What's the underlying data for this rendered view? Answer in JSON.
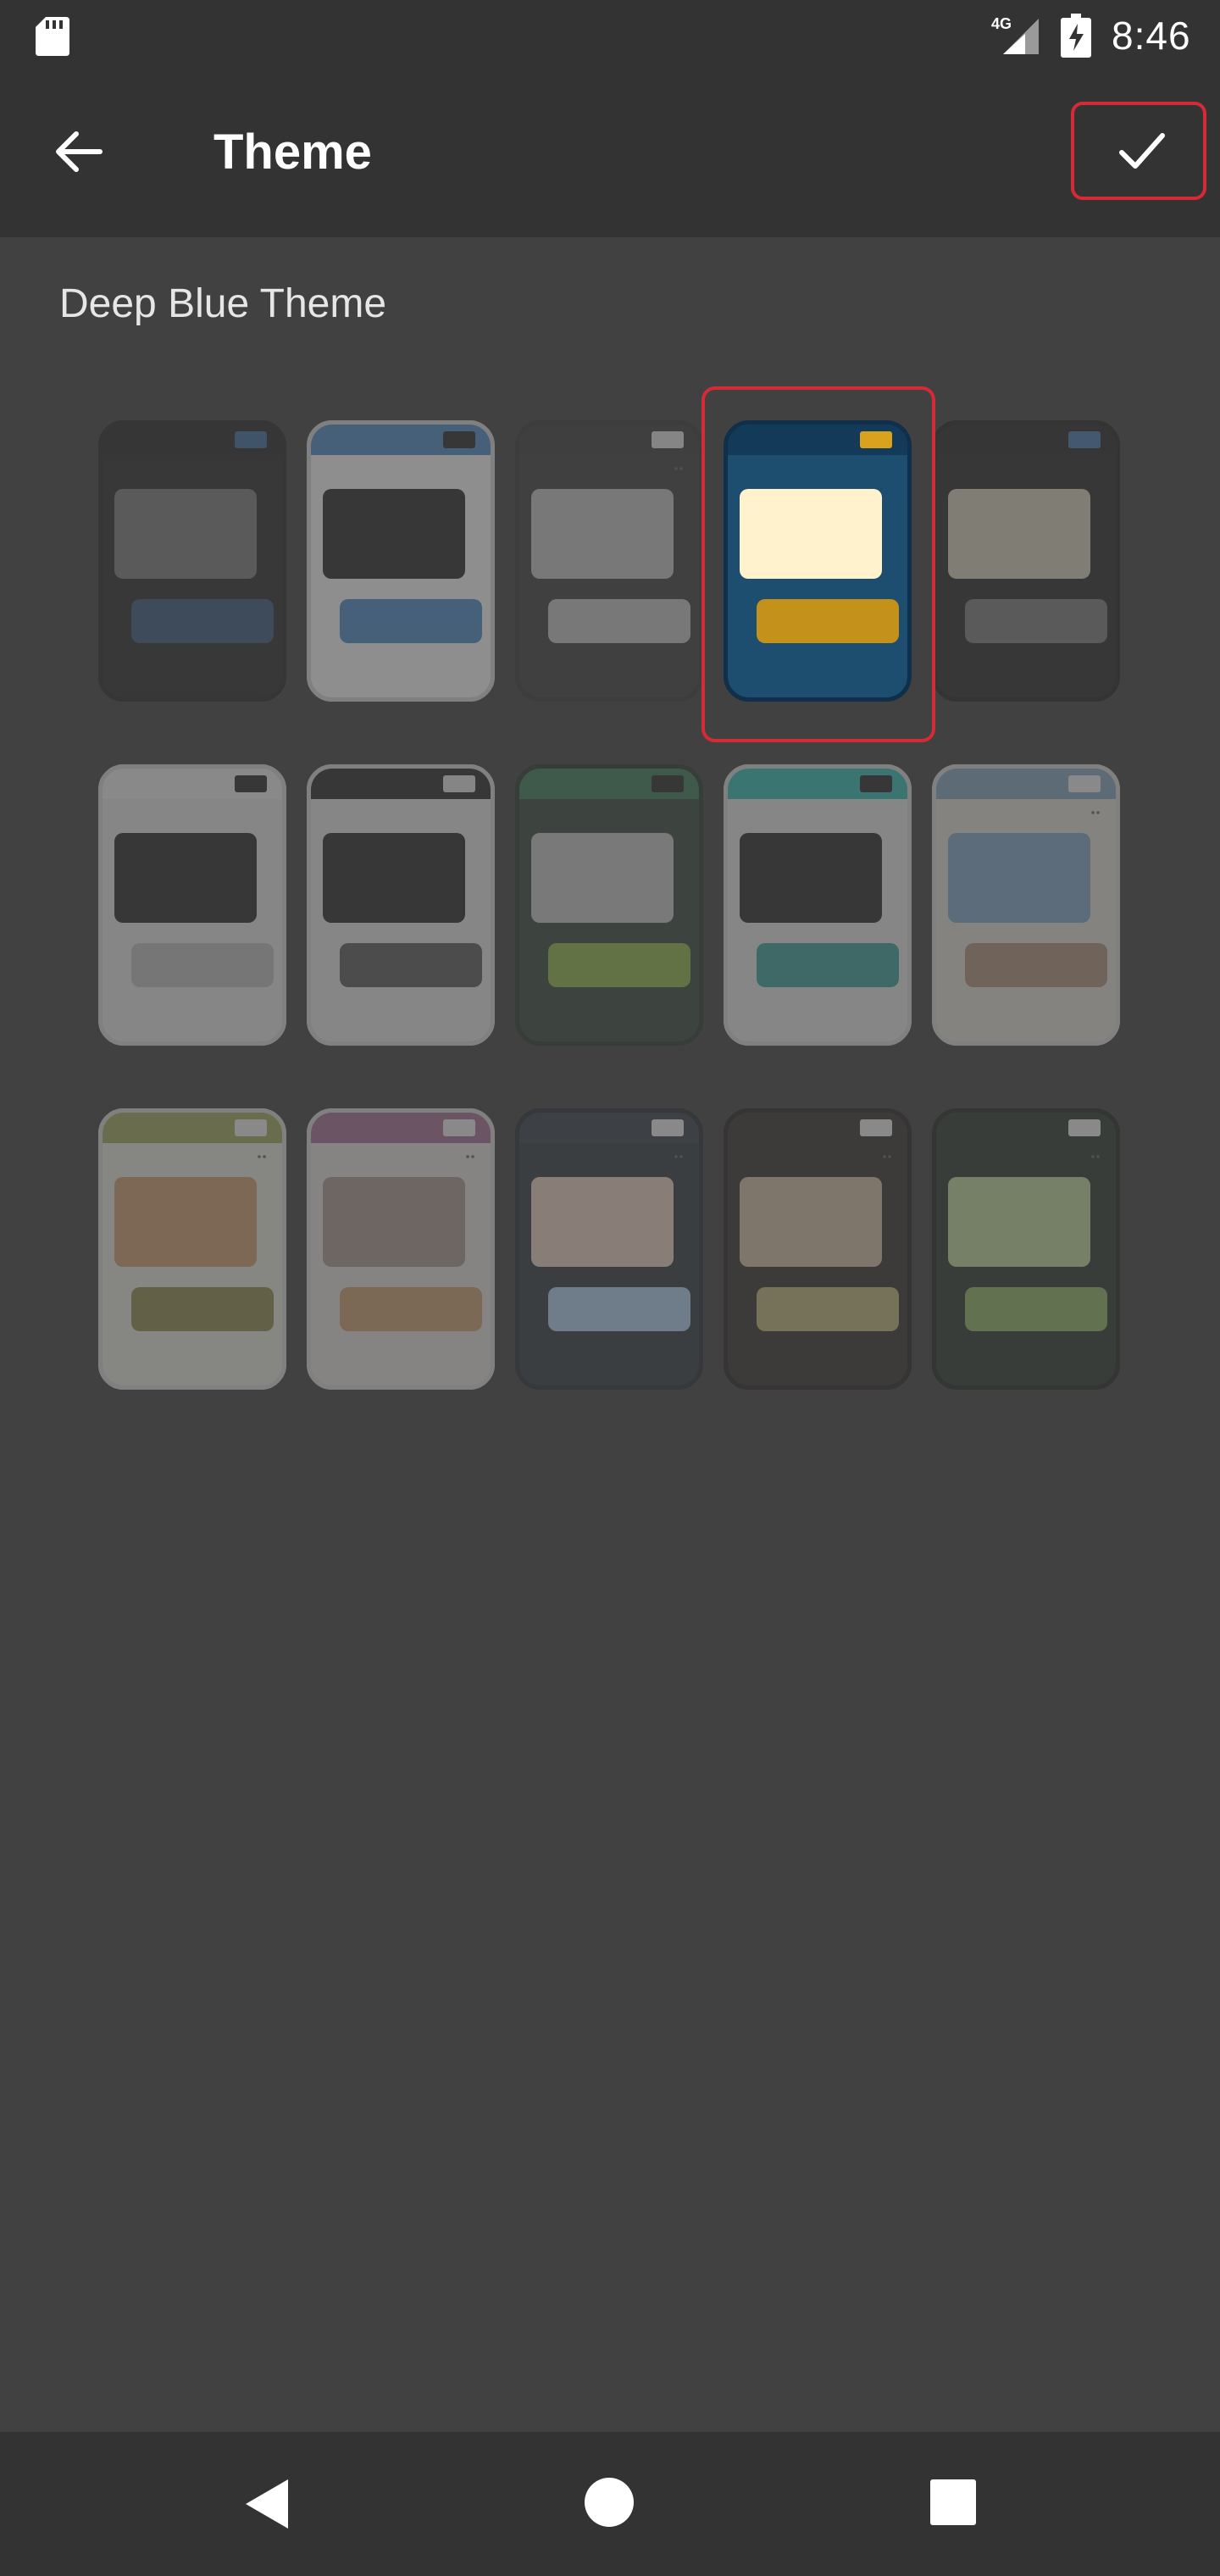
{
  "status_bar": {
    "time": "8:46",
    "network": "4G",
    "icons": [
      "sd-card-icon",
      "signal-icon",
      "battery-charging-icon"
    ]
  },
  "app_bar": {
    "title": "Theme",
    "back_icon": "arrow-left-icon",
    "confirm_icon": "check-icon"
  },
  "selected_theme_name": "Deep Blue Theme",
  "themes": [
    {
      "frame": "#2a2a2a",
      "bg": "#2f2f2f",
      "top": "#2a2a2a",
      "chip": "#3e6d99",
      "card": "#7a7a7a",
      "btn": "#3a5a7a",
      "dots": false,
      "selected": false
    },
    {
      "frame": "#cfcfcf",
      "bg": "#eeeeee",
      "top": "#4f87c0",
      "chip": "#2d2d2d",
      "card": "#2d2d2d",
      "btn": "#4f87c0",
      "dots": false,
      "selected": false
    },
    {
      "frame": "#3a3a3a",
      "bg": "#424242",
      "top": "#3f3f3f",
      "chip": "#d9d9d9",
      "card": "#bdbdbd",
      "btn": "#bdbdbd",
      "dots": true,
      "selected": false
    },
    {
      "frame": "#0f2f4a",
      "bg": "#1d4e70",
      "top": "#143a59",
      "chip": "#d9a21e",
      "card": "#fff2cc",
      "btn": "#c4921a",
      "dots": false,
      "selected": true
    },
    {
      "frame": "#262626",
      "bg": "#2d2d2d",
      "top": "#2b2b2b",
      "chip": "#4a79ab",
      "card": "#cfc7b4",
      "btn": "#7a7a7a",
      "dots": false,
      "selected": false
    },
    {
      "frame": "#cfcfcf",
      "bg": "#dcdcdc",
      "top": "#e2e2e2",
      "chip": "#2d2d2d",
      "card": "#2d2d2d",
      "btn": "#b8b8b8",
      "dots": false,
      "selected": false
    },
    {
      "frame": "#cfcfcf",
      "bg": "#dcdcdc",
      "top": "#2d2d2d",
      "chip": "#d9d9d9",
      "card": "#2d2d2d",
      "btn": "#5b5b5b",
      "dots": false,
      "selected": false
    },
    {
      "frame": "#2e3b31",
      "bg": "#3b4a3e",
      "top": "#3e7a58",
      "chip": "#2d2d2d",
      "card": "#bfbfbf",
      "btn": "#8fb04a",
      "dots": false,
      "selected": false
    },
    {
      "frame": "#cfcfcf",
      "bg": "#dcdcdc",
      "top": "#35b6b0",
      "chip": "#2d2d2d",
      "card": "#2d2d2d",
      "btn": "#3f9c97",
      "dots": false,
      "selected": false
    },
    {
      "frame": "#cfcfcf",
      "bg": "#d9d5ce",
      "top": "#7fa0b9",
      "chip": "#e3e3e3",
      "card": "#7ea3c4",
      "btn": "#a98f7a",
      "dots": true,
      "selected": false
    },
    {
      "frame": "#cfcfcf",
      "bg": "#dcdbd2",
      "top": "#9ea35f",
      "chip": "#e3e3e3",
      "card": "#c69a6e",
      "btn": "#8d8a50",
      "dots": true,
      "selected": false
    },
    {
      "frame": "#cfcfcf",
      "bg": "#dcd7d5",
      "top": "#a06f90",
      "chip": "#e3e3e3",
      "card": "#a4958f",
      "btn": "#c39b70",
      "dots": true,
      "selected": false
    },
    {
      "frame": "#2b2f35",
      "bg": "#353c44",
      "top": "#3a424c",
      "chip": "#e3e3e3",
      "card": "#e3cbbb",
      "btn": "#a8c6e2",
      "dots": true,
      "selected": false
    },
    {
      "frame": "#2a2626",
      "bg": "#3a3333",
      "top": "#3a3333",
      "chip": "#e3e3e3",
      "card": "#c9b8a0",
      "btn": "#b8ad78",
      "dots": true,
      "selected": false
    },
    {
      "frame": "#262b26",
      "bg": "#323a33",
      "top": "#323a33",
      "chip": "#e3e3e3",
      "card": "#b7cf97",
      "btn": "#8db066",
      "dots": true,
      "selected": false
    }
  ],
  "nav_bar": {
    "back_icon": "nav-back-icon",
    "home_icon": "nav-home-icon",
    "recents_icon": "nav-recents-icon"
  }
}
